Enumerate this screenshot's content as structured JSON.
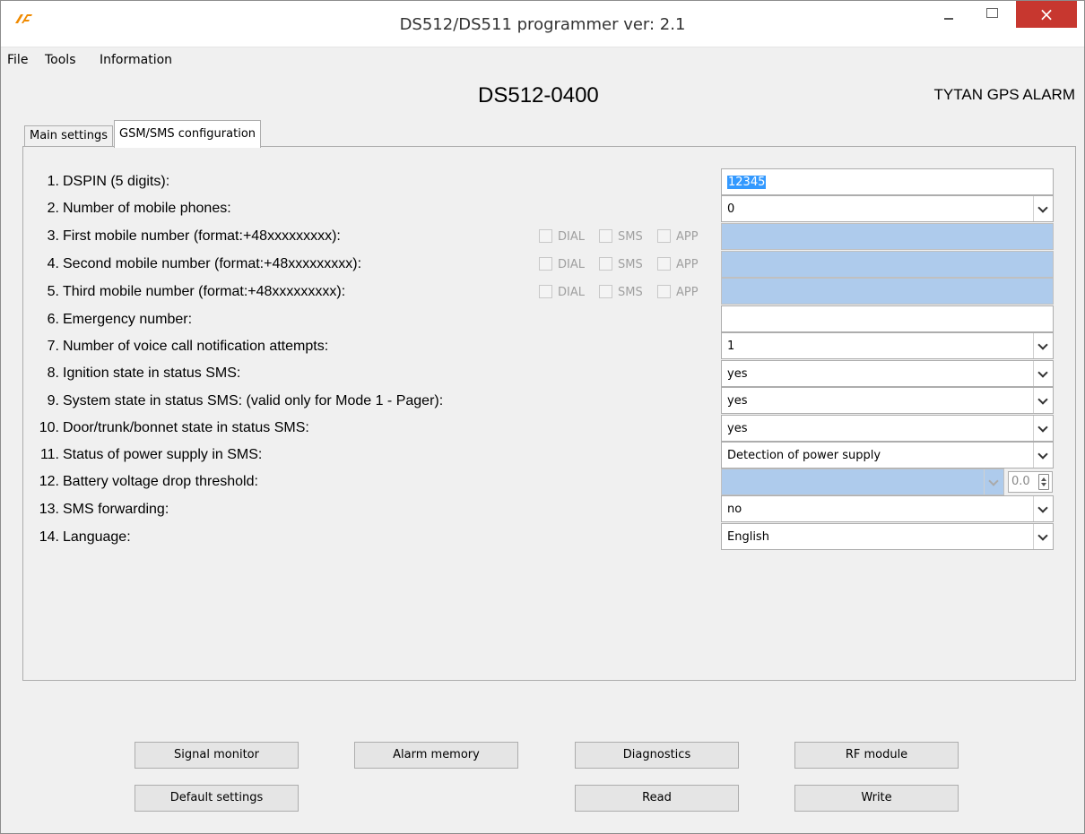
{
  "window": {
    "title": "DS512/DS511 programmer ver:  2.1",
    "close_glyph": "×"
  },
  "menu": {
    "items": [
      {
        "label": "File"
      },
      {
        "label": "Tools"
      },
      {
        "label": "Information"
      }
    ]
  },
  "header": {
    "device": "DS512-0400",
    "brand": "TYTAN GPS ALARM"
  },
  "tabs": [
    {
      "label": "Main settings",
      "active": false
    },
    {
      "label": "GSM/SMS configuration",
      "active": true
    }
  ],
  "settings": [
    {
      "num": "1.",
      "label": "DSPIN (5 digits):",
      "value": "12345"
    },
    {
      "num": "2.",
      "label": "Number of mobile phones:",
      "value": "0"
    },
    {
      "num": "3.",
      "label": "First mobile number (format:+48xxxxxxxxx):",
      "value": ""
    },
    {
      "num": "4.",
      "label": "Second mobile number (format:+48xxxxxxxxx):",
      "value": ""
    },
    {
      "num": "5.",
      "label": "Third mobile number (format:+48xxxxxxxxx):",
      "value": ""
    },
    {
      "num": "6.",
      "label": "Emergency number:",
      "value": ""
    },
    {
      "num": "7.",
      "label": "Number of voice call notification attempts:",
      "value": "1"
    },
    {
      "num": "8.",
      "label": "Ignition state in status SMS:",
      "value": "yes"
    },
    {
      "num": "9.",
      "label": "System state in status SMS: (valid only for Mode 1 - Pager):",
      "value": "yes"
    },
    {
      "num": "10.",
      "label": "Door/trunk/bonnet state in status SMS:",
      "value": "yes"
    },
    {
      "num": "11.",
      "label": "Status of power supply in SMS:",
      "value": "Detection of power supply"
    },
    {
      "num": "12.",
      "label": "Battery voltage drop threshold:",
      "value": "",
      "spin_value": "0.0"
    },
    {
      "num": "13.",
      "label": "SMS forwarding:",
      "value": "no"
    },
    {
      "num": "14.",
      "label": "Language:",
      "value": "English"
    }
  ],
  "notify_options": [
    "DIAL",
    "SMS",
    "APP"
  ],
  "buttons": {
    "signal_monitor": "Signal monitor",
    "alarm_memory": "Alarm memory",
    "diagnostics": "Diagnostics",
    "rf_module": "RF module",
    "default_settings": "Default settings",
    "read": "Read",
    "write": "Write"
  }
}
